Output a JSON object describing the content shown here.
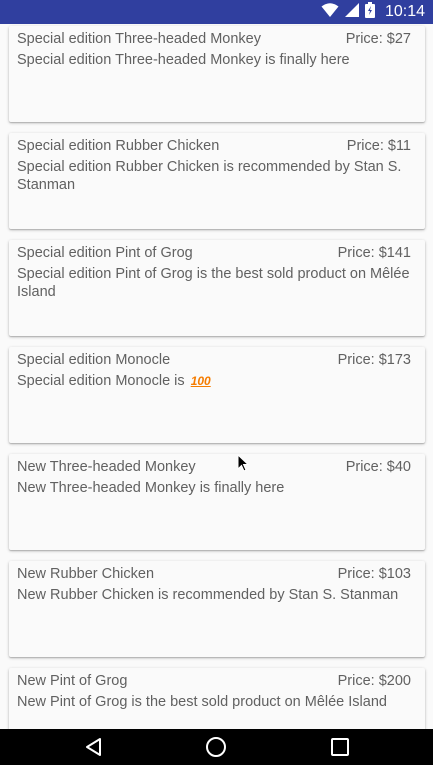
{
  "status_bar": {
    "time": "10:14",
    "icons": [
      "wifi-icon",
      "signal-icon",
      "battery-icon"
    ],
    "background": "#303f9f"
  },
  "products": [
    {
      "name": "Special edition Three-headed Monkey",
      "price": "Price: $27",
      "description": "Special edition Three-headed Monkey is finally here"
    },
    {
      "name": "Special edition Rubber Chicken",
      "price": "Price: $11",
      "description": "Special edition Rubber Chicken is recommended by Stan S. Stanman"
    },
    {
      "name": "Special edition Pint of Grog",
      "price": "Price: $141",
      "description": "Special edition Pint of Grog is the best sold product on Mêlée Island"
    },
    {
      "name": "Special edition Monocle",
      "price": "Price: $173",
      "description": "Special edition Monocle is",
      "emoji": "100"
    },
    {
      "name": "New Three-headed Monkey",
      "price": "Price: $40",
      "description": "New Three-headed Monkey is finally here"
    },
    {
      "name": "New Rubber Chicken",
      "price": "Price: $103",
      "description": "New Rubber Chicken is recommended by Stan S. Stanman"
    },
    {
      "name": "New Pint of Grog",
      "price": "Price: $200",
      "description": "New Pint of Grog is the best sold product on Mêlée Island"
    }
  ],
  "nav_bar": {
    "buttons": [
      "back-icon",
      "home-icon",
      "recents-icon"
    ]
  }
}
